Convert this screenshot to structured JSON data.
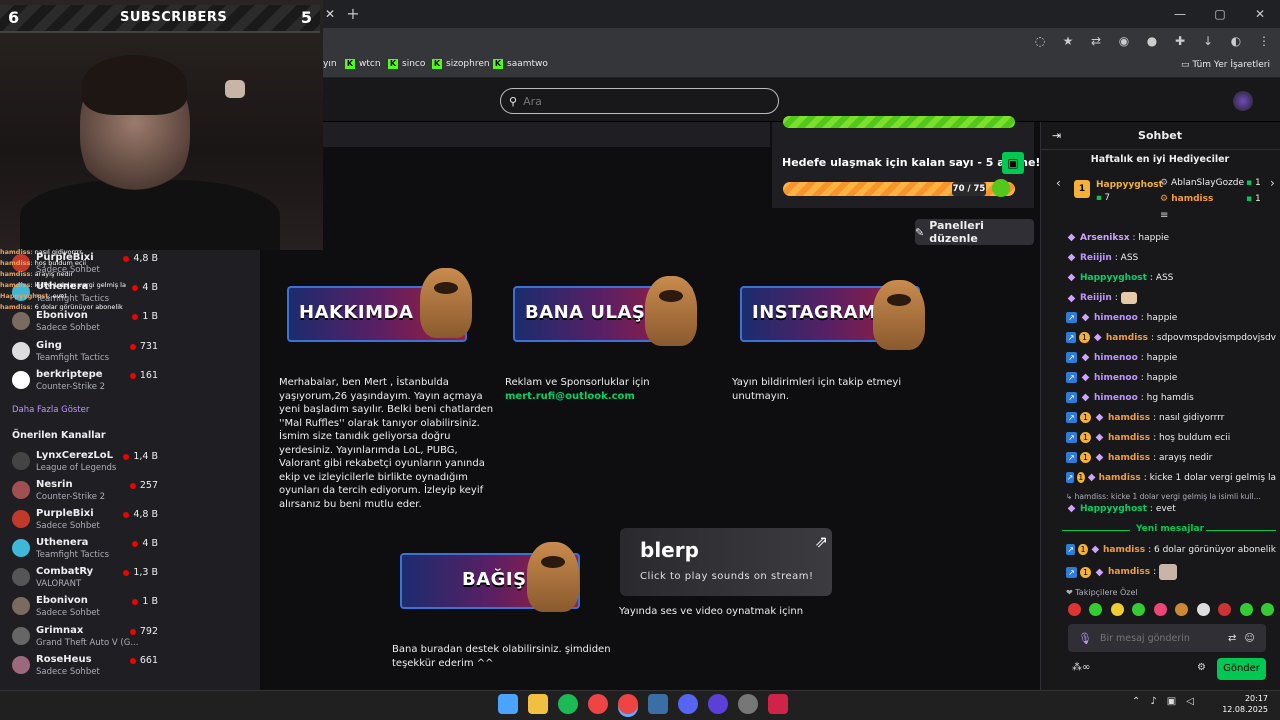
{
  "browser": {
    "new_tab": "+",
    "tab_close": "✕",
    "window_controls": [
      "—",
      "▢",
      "✕"
    ],
    "bookmarks": [
      "yın",
      "wtcn",
      "sinco",
      "sizophren",
      "saamtwo"
    ],
    "all_bookmarks": "Tüm Yer İşaretleri"
  },
  "header": {
    "search_placeholder": "Ara"
  },
  "overlay": {
    "sub_left": "6",
    "sub_title": "SUBSCRIBERS",
    "sub_right": "5",
    "chat_lines": [
      {
        "user": "hamdiss",
        "text": ": nasıl gidiyorrrr"
      },
      {
        "user": "hamdiss",
        "text": ": hoş buldum ecii"
      },
      {
        "user": "hamdiss",
        "text": ": arayış nedir"
      },
      {
        "user": "hamdiss",
        "text": ": kicke 1 dolar vergi gelmiş la"
      },
      {
        "user": "Happyyghost",
        "text": ": evet"
      },
      {
        "user": "hamdiss",
        "text": ": 6 dolar görünüyor abonelik"
      },
      {
        "user": "hamdiss",
        "text": ":"
      }
    ]
  },
  "sidebar": {
    "followed": [
      {
        "name": "PurpleBixi",
        "category": "Sadece Sohbet",
        "viewers": "4,8 B",
        "color": "#c0392b"
      },
      {
        "name": "Uthenera",
        "category": "Teamfight Tactics",
        "viewers": "4 B",
        "color": "#3fb8d8"
      },
      {
        "name": "Ebonivon",
        "category": "Sadece Sohbet",
        "viewers": "1 B",
        "color": "#7a6a60"
      },
      {
        "name": "Ging",
        "category": "Teamfight Tactics",
        "viewers": "731",
        "color": "#ddd"
      },
      {
        "name": "berkriptepe",
        "category": "Counter-Strike 2",
        "viewers": "161",
        "color": "#fff"
      }
    ],
    "show_more": "Daha Fazla Göster",
    "recommended_title": "Önerilen Kanallar",
    "recommended": [
      {
        "name": "LynxCerezLoL",
        "category": "League of Legends",
        "viewers": "1,4 B",
        "color": "#444"
      },
      {
        "name": "Nesrin",
        "category": "Counter-Strike 2",
        "viewers": "257",
        "color": "#a05050"
      },
      {
        "name": "PurpleBixi",
        "category": "Sadece Sohbet",
        "viewers": "4,8 B",
        "color": "#c0392b"
      },
      {
        "name": "Uthenera",
        "category": "Teamfight Tactics",
        "viewers": "4 B",
        "color": "#3fb8d8"
      },
      {
        "name": "CombatRy",
        "category": "VALORANT",
        "viewers": "1,3 B",
        "color": "#555"
      },
      {
        "name": "Ebonivon",
        "category": "Sadece Sohbet",
        "viewers": "1 B",
        "color": "#7a6a60"
      },
      {
        "name": "Grimnax",
        "category": "Grand Theft Auto V (G...",
        "viewers": "792",
        "color": "#666"
      },
      {
        "name": "RoseHeus",
        "category": "Sadece Sohbet",
        "viewers": "661",
        "color": "#9a6a7a"
      }
    ]
  },
  "goal": {
    "text": "Hedefe ulaşmak için kalan sayı - 5 abone!",
    "count": "70 / 75",
    "progress": 0.93
  },
  "edit_panels": "Panelleri düzenle",
  "panels": [
    {
      "title": "HAKKIMDA",
      "text": "Merhabalar, ben Mert , İstanbulda yaşıyorum,26 yaşındayım. Yayın açmaya yeni başladım sayılır. Belki beni chatlarden ''Mal Ruffles'' olarak tanıyor olabilirsiniz. İsmim size tanıdık geliyorsa doğru yerdesiniz. Yayınlarımda LoL, PUBG, Valorant gibi rekabetçi oyunların yanında ekip ve izleyicilerle birlikte oynadığım oyunları da tercih ediyorum. İzleyip keyif alırsanız bu beni mutlu eder."
    },
    {
      "title": "BANA ULAŞIN",
      "text": "Reklam ve Sponsorluklar için",
      "link": "mert.rufi@outlook.com"
    },
    {
      "title": "INSTAGRAM",
      "text": "Yayın bildirimleri için takip etmeyi unutmayın."
    },
    {
      "title": "BAĞIŞ",
      "text": "Bana buradan destek olabilirsiniz. şimdiden teşekkür ederim ^^"
    }
  ],
  "blerp": {
    "logo": "blerp",
    "sub": "Click to play sounds on stream!",
    "caption": "Yayında ses ve video oynatmak içinn"
  },
  "chat": {
    "title": "Sohbet",
    "gifters_title": "Haftalık en iyi Hediyeciler",
    "gifters": [
      {
        "rank": "1",
        "name": "Happyyghost",
        "count": "7"
      },
      {
        "name": "AblanSlayGozde",
        "count": "1"
      },
      {
        "name": "hamdiss",
        "count": "1"
      }
    ],
    "messages": [
      {
        "user": "Arseniksx",
        "text": ": happie",
        "color": "#d0a3ff",
        "badges": [
          "g"
        ]
      },
      {
        "user": "Reiijin",
        "text": ": ASS",
        "color": "#bf94ff",
        "badges": [
          "g"
        ]
      },
      {
        "user": "Happyyghost",
        "text": ": ASS",
        "color": "#00d26a",
        "badges": [
          "g"
        ]
      },
      {
        "user": "Reiijin",
        "text": ":",
        "color": "#bf94ff",
        "badges": [
          "g"
        ]
      },
      {
        "user": "himenoo",
        "text": ": happie",
        "color": "#bf94ff",
        "badges": [
          "p",
          "g"
        ]
      },
      {
        "user": "hamdiss",
        "text": ": sdpovmspdovjsmpdovjsdv",
        "color": "#f39c3a",
        "badges": [
          "p",
          "s",
          "g"
        ]
      },
      {
        "user": "himenoo",
        "text": ": happie",
        "color": "#bf94ff",
        "badges": [
          "p",
          "g"
        ]
      },
      {
        "user": "himenoo",
        "text": ": happie",
        "color": "#bf94ff",
        "badges": [
          "p",
          "g"
        ]
      },
      {
        "user": "himenoo",
        "text": ": hg hamdis",
        "color": "#bf94ff",
        "badges": [
          "p",
          "g"
        ]
      },
      {
        "user": "hamdiss",
        "text": ": nasıl gidiyorrrr",
        "color": "#f39c3a",
        "badges": [
          "p",
          "s",
          "g"
        ]
      },
      {
        "user": "hamdiss",
        "text": ": hoş buldum ecii",
        "color": "#f39c3a",
        "badges": [
          "p",
          "s",
          "g"
        ]
      },
      {
        "user": "hamdiss",
        "text": ": arayış nedir",
        "color": "#f39c3a",
        "badges": [
          "p",
          "s",
          "g"
        ]
      },
      {
        "user": "hamdiss",
        "text": ": kicke 1 dolar vergi gelmiş la",
        "color": "#f39c3a",
        "badges": [
          "p",
          "s",
          "g"
        ]
      }
    ],
    "reply_preview": "↳ hamdiss: kicke 1 dolar vergi gelmiş la isimli kull...",
    "reply_msg": {
      "user": "Happyyghost",
      "text": ": evet",
      "color": "#00d26a"
    },
    "new_messages": "Yeni mesajlar",
    "new": [
      {
        "user": "hamdiss",
        "text": ": 6 dolar görünüyor abonelik",
        "color": "#f39c3a"
      },
      {
        "user": "hamdiss",
        "text": ":",
        "color": "#f39c3a"
      }
    ],
    "followers_only": "❤ Takipçilere Özel",
    "input_placeholder": "Bir mesaj gönderin",
    "send": "Gönder"
  },
  "taskbar": {
    "time": "20:17",
    "date": "12.08.2025"
  }
}
